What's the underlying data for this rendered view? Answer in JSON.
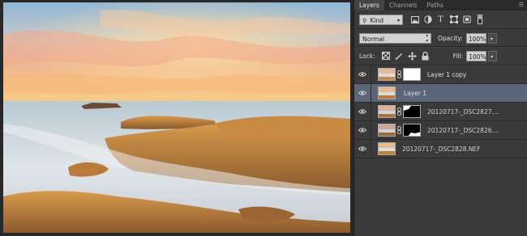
{
  "tabs": [
    {
      "label": "Layers",
      "active": true
    },
    {
      "label": "Channels",
      "active": false
    },
    {
      "label": "Paths",
      "active": false
    }
  ],
  "filter": {
    "kind_label": "Kind",
    "icons": [
      "image-filter-icon",
      "adjustment-filter-icon",
      "type-filter-icon",
      "shape-filter-icon",
      "smart-object-filter-icon",
      "filter-toggle-icon"
    ]
  },
  "blend": {
    "mode": "Normal",
    "opacity_label": "Opacity:",
    "opacity_value": "100%"
  },
  "lock": {
    "label": "Lock:",
    "icons": [
      "lock-transparent-icon",
      "lock-image-icon",
      "lock-position-icon",
      "lock-all-icon"
    ],
    "fill_label": "Fill:",
    "fill_value": "100%"
  },
  "layers": [
    {
      "name": "Layer 1 copy",
      "selected": false,
      "has_mask": true,
      "mask": "white"
    },
    {
      "name": "Layer 1",
      "selected": true,
      "has_mask": false,
      "mask": ""
    },
    {
      "name": "20120717-_DSC2827....",
      "selected": false,
      "has_mask": true,
      "mask": "black-mostly"
    },
    {
      "name": "20120717-_DSC2826....",
      "selected": false,
      "has_mask": true,
      "mask": "black-white-bottom"
    },
    {
      "name": "20120717-_DSC2828.NEF",
      "selected": false,
      "has_mask": false,
      "mask": ""
    }
  ],
  "colors": {
    "panel": "#3a3a3a",
    "selected_layer": "#5b6779",
    "canvas_bg": "#282828"
  }
}
